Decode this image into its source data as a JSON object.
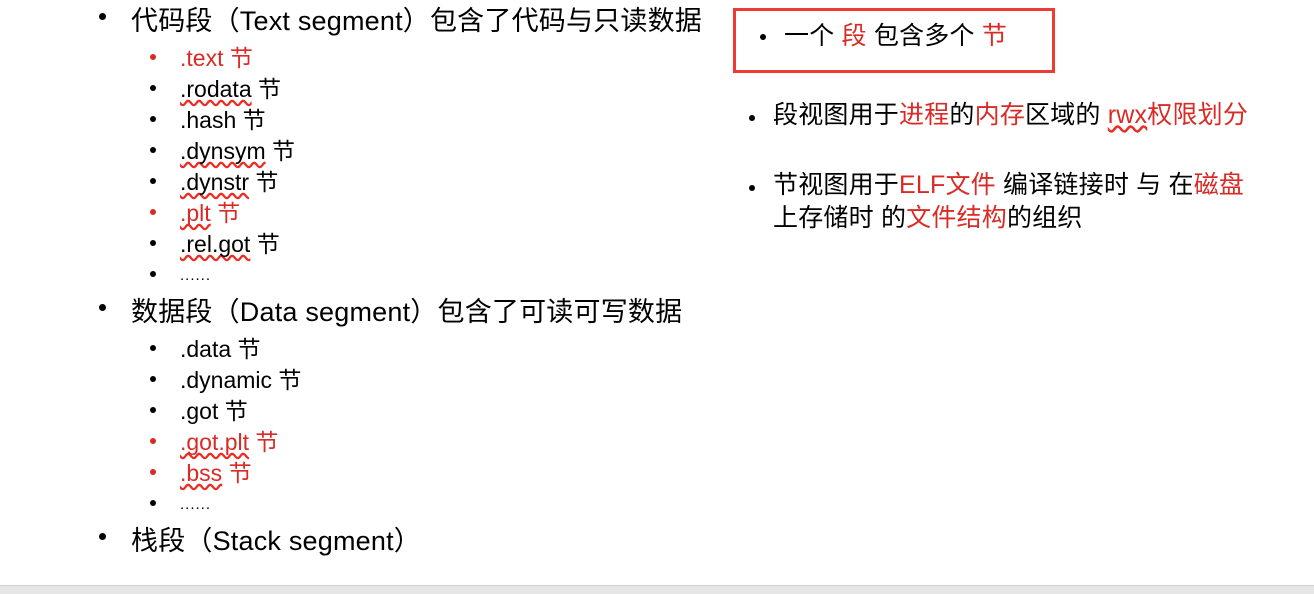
{
  "slide": {
    "left_column": [
      {
        "level": 1,
        "name": "text-segment-heading",
        "text": "代码段（Text segment）包含了代码与只读数据",
        "color": "black"
      },
      {
        "level": 2,
        "name": "section-text",
        "text": ".text 节",
        "color": "red",
        "bullet_color": "red",
        "squiggle": false
      },
      {
        "level": 2,
        "name": "section-rodata",
        "text": ".rodata 节",
        "color": "black",
        "bullet_color": "black",
        "squiggle": true,
        "squiggle_part": ".rodata"
      },
      {
        "level": 2,
        "name": "section-hash",
        "text": ".hash 节",
        "color": "black",
        "bullet_color": "black",
        "squiggle": false
      },
      {
        "level": 2,
        "name": "section-dynsym",
        "text": ".dynsym 节",
        "color": "black",
        "bullet_color": "black",
        "squiggle": true,
        "squiggle_part": ".dynsym"
      },
      {
        "level": 2,
        "name": "section-dynstr",
        "text": ".dynstr 节",
        "color": "black",
        "bullet_color": "black",
        "squiggle": true,
        "squiggle_part": ".dynstr"
      },
      {
        "level": 2,
        "name": "section-plt",
        "text": ".plt 节",
        "color": "red",
        "bullet_color": "red",
        "squiggle": true,
        "squiggle_part": ".plt"
      },
      {
        "level": 2,
        "name": "section-rel-got",
        "text": ".rel.got 节",
        "color": "black",
        "bullet_color": "black",
        "squiggle": true,
        "squiggle_part": ".rel.got"
      },
      {
        "level": 2,
        "name": "section-ellipsis-text",
        "text": "......",
        "color": "black",
        "bullet_color": "black",
        "squiggle": false,
        "small": true
      },
      {
        "level": 1,
        "name": "data-segment-heading",
        "text": "数据段（Data segment）包含了可读可写数据",
        "color": "black"
      },
      {
        "level": 2,
        "name": "section-data",
        "text": ".data 节",
        "color": "black",
        "bullet_color": "black",
        "squiggle": false
      },
      {
        "level": 2,
        "name": "section-dynamic",
        "text": ".dynamic 节",
        "color": "black",
        "bullet_color": "black",
        "squiggle": false
      },
      {
        "level": 2,
        "name": "section-got",
        "text": ".got 节",
        "color": "black",
        "bullet_color": "black",
        "squiggle": false
      },
      {
        "level": 2,
        "name": "section-got-plt",
        "text": ".got.plt 节",
        "color": "red",
        "bullet_color": "red",
        "squiggle": true,
        "squiggle_part": ".got.plt"
      },
      {
        "level": 2,
        "name": "section-bss",
        "text": ".bss 节",
        "color": "red",
        "bullet_color": "red",
        "squiggle": true,
        "squiggle_part": ".bss"
      },
      {
        "level": 2,
        "name": "section-ellipsis-data",
        "text": "......",
        "color": "black",
        "bullet_color": "black",
        "squiggle": false,
        "small": true
      },
      {
        "level": 1,
        "name": "stack-segment-heading",
        "text": "栈段（Stack segment）",
        "color": "black"
      }
    ],
    "highlight_box": {
      "border_color": "#ee3b33",
      "bullet": {
        "name": "segment-contains-sections",
        "runs": [
          {
            "t": "一个 ",
            "c": "black"
          },
          {
            "t": "段",
            "c": "red"
          },
          {
            "t": " 包含多个 ",
            "c": "black"
          },
          {
            "t": "节",
            "c": "red"
          }
        ]
      }
    },
    "right_column": [
      {
        "name": "segment-view-description",
        "runs": [
          {
            "t": "段视图用于",
            "c": "black"
          },
          {
            "t": "进程",
            "c": "red"
          },
          {
            "t": "的",
            "c": "black"
          },
          {
            "t": "内存",
            "c": "red"
          },
          {
            "t": "区域的 ",
            "c": "black"
          },
          {
            "t": "rwx",
            "c": "red",
            "squiggle": true
          },
          {
            "t": "权限划分",
            "c": "red"
          }
        ]
      },
      {
        "name": "section-view-description",
        "runs": [
          {
            "t": "节视图用于",
            "c": "black"
          },
          {
            "t": "ELF文件",
            "c": "red"
          },
          {
            "t": " 编译链接时 与 在",
            "c": "black"
          },
          {
            "t": "磁盘",
            "c": "red"
          },
          {
            "t": "\n上存储时 的",
            "c": "black"
          },
          {
            "t": "文件结构",
            "c": "red"
          },
          {
            "t": "的组织",
            "c": "black"
          }
        ]
      }
    ],
    "colors": {
      "accent_red": "#d92b26",
      "box_red": "#ee3b33",
      "squiggle_red": "#ee2b22",
      "footer_gray": "#e6e6e6",
      "text_black": "#000000"
    }
  }
}
